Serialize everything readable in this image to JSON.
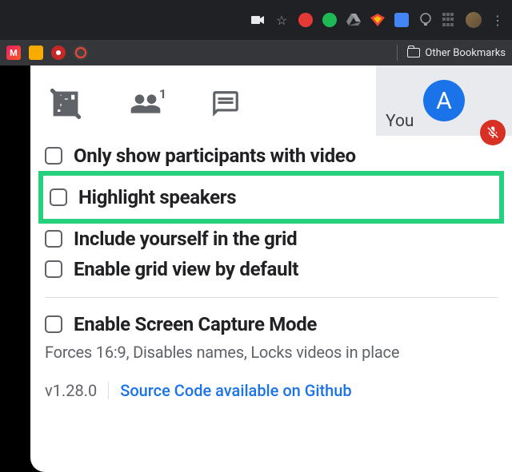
{
  "topbar": {
    "icons": [
      "camera-icon",
      "star-icon",
      "shield-icon",
      "grammarly-icon",
      "drive-icon",
      "superhero-icon",
      "library-icon",
      "bulb-icon",
      "grid-icon",
      "avatar-icon",
      "more-icon"
    ]
  },
  "bookmarks": {
    "items": [
      "myntra-icon",
      "notes-icon",
      "youtube-music-icon",
      "netflix-icon"
    ],
    "folder_label": "Other Bookmarks"
  },
  "tabs": {
    "grid_icon": "grid-off",
    "people_icon": "people",
    "people_badge": "1",
    "chat_icon": "chat"
  },
  "self_tile": {
    "label": "You",
    "avatar_letter": "A",
    "muted": true
  },
  "options": [
    {
      "label": "Only show participants with video",
      "checked": false
    },
    {
      "label": "Highlight speakers",
      "checked": false,
      "highlighted": true
    },
    {
      "label": "Include yourself in the grid",
      "checked": false
    },
    {
      "label": "Enable grid view by default",
      "checked": false
    }
  ],
  "capture": {
    "label": "Enable Screen Capture Mode",
    "desc": "Forces 16:9, Disables names, Locks videos in place"
  },
  "footer": {
    "version": "v1.28.0",
    "link": "Source Code available on Github"
  }
}
